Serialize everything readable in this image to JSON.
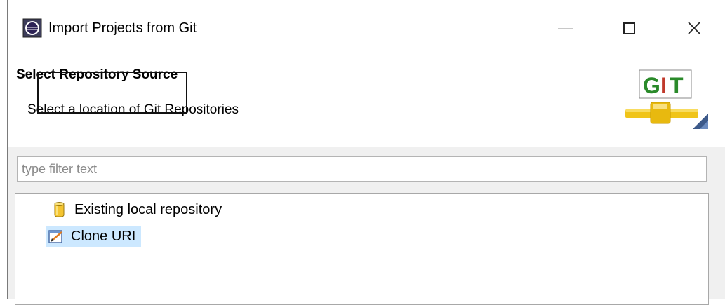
{
  "window": {
    "title": "Import Projects from Git",
    "icons": {
      "app": "eclipse-icon",
      "minimize": "minimize-icon",
      "maximize": "maximize-icon",
      "close": "close-icon"
    },
    "close_glyph": "✕"
  },
  "banner": {
    "title": "Select Repository Source",
    "description": "Select a location of Git Repositories",
    "logo_text": "GIT",
    "logo_icon": "git-logo-icon"
  },
  "filter": {
    "placeholder": "type filter text",
    "value": ""
  },
  "tree": {
    "items": [
      {
        "label": "Existing local repository",
        "icon": "repository-cylinder-icon"
      },
      {
        "label": "Clone URI",
        "icon": "clone-uri-icon",
        "selected": true
      }
    ]
  },
  "colors": {
    "selection": "#cce8ff",
    "git_green": "#2a8a2a",
    "git_red": "#c0392b",
    "pipe_yellow": "#f0c419"
  }
}
